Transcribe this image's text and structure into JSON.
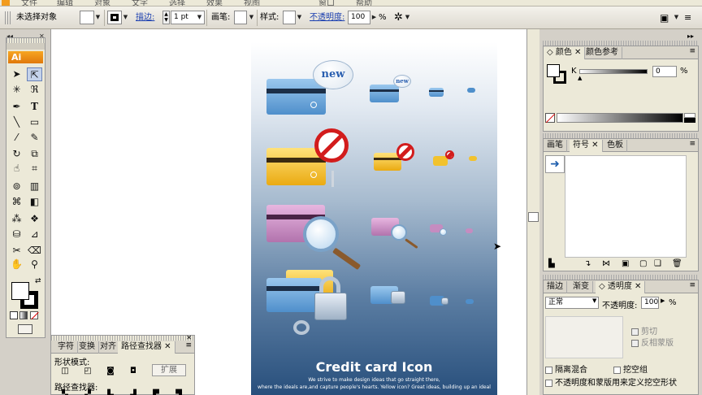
{
  "menubar": {
    "items": [
      "文件",
      "编辑",
      "对象",
      "文字",
      "选择",
      "效果",
      "视图",
      "窗口",
      "帮助"
    ]
  },
  "control": {
    "selection_label": "未选择对象",
    "stroke_label": "描边:",
    "stroke_value": "1 pt",
    "brush_label": "画笔:",
    "style_label": "样式:",
    "opacity_label": "不透明度:",
    "opacity_value": "100",
    "percent": "%"
  },
  "toolbox": {
    "logo": "Ai",
    "tool_icons": [
      "selection-tool",
      "direct-selection-tool",
      "magic-wand-tool",
      "lasso-tool",
      "pen-tool",
      "type-tool",
      "line-tool",
      "rectangle-tool",
      "paintbrush-tool",
      "pencil-tool",
      "rotate-tool",
      "scale-tool",
      "warp-tool",
      "free-transform-tool",
      "symbol-sprayer-tool",
      "column-graph-tool",
      "mesh-tool",
      "gradient-tool",
      "eyedropper-tool",
      "blend-tool",
      "live-paint-tool",
      "slice-tool",
      "scissors-tool",
      "eraser-tool",
      "hand-tool",
      "zoom-tool"
    ]
  },
  "artwork": {
    "bubble_text": "new",
    "title": "Credit card Icon",
    "subtitle_1": "We strive to make design ideas that go straight there,",
    "subtitle_2": "where the ideals are,and capture people's hearts. Yellow icon? Great ideas, building up an ideal"
  },
  "colors": {
    "accent_orange": "#f29b1d",
    "card_blue": "#6fa6d8",
    "card_yellow": "#f2c22d",
    "card_purple": "#c58cc0",
    "no_sign_red": "#d21c1c",
    "link_blue": "#1b3fb0"
  },
  "color_panel": {
    "tabs": [
      "颜色",
      "颜色参考"
    ],
    "channel_label": "K",
    "channel_value": "0",
    "percent": "%"
  },
  "brush_panel": {
    "tabs": [
      "画笔",
      "符号",
      "色板"
    ]
  },
  "transparency_panel": {
    "tabs": [
      "描边",
      "渐变",
      "透明度"
    ],
    "blend_mode": "正常",
    "opacity_label": "不透明度:",
    "opacity_value": "100",
    "percent": "%",
    "clip_label": "剪切",
    "invert_mask_label": "反相蒙版",
    "isolate_blending_label": "隔离混合",
    "knockout_group_label": "挖空组",
    "opacity_mask_label": "不透明度和蒙版用来定义挖空形状"
  },
  "pathfinder_panel": {
    "tabs": [
      "字符",
      "变换",
      "对齐",
      "路径查找器"
    ],
    "shape_modes_label": "形状模式:",
    "expand_label": "扩展",
    "pathfinders_label": "路径查找器:"
  }
}
